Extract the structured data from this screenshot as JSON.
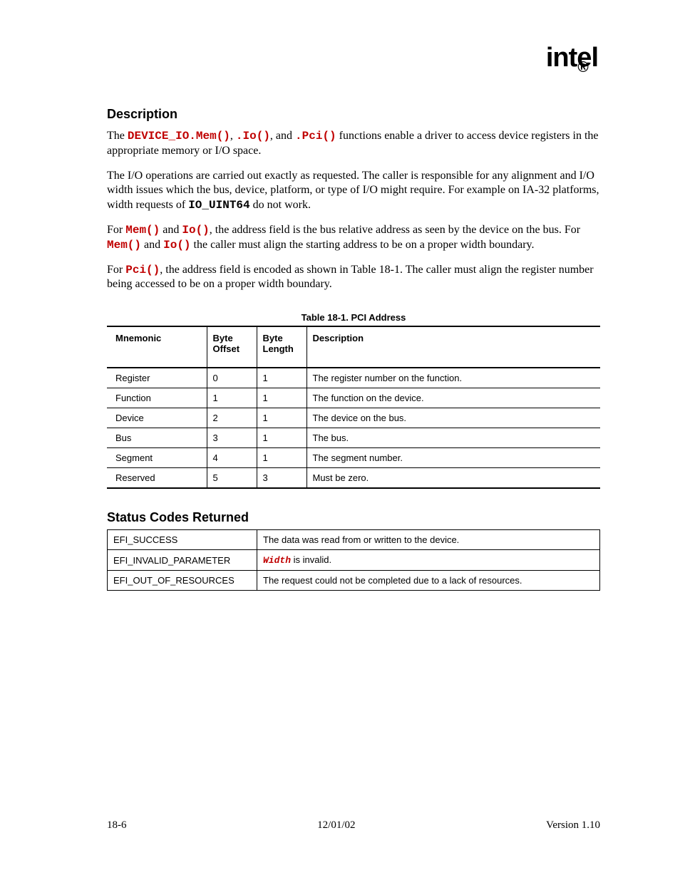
{
  "logo": "intel",
  "sections": {
    "desc_heading": "Description",
    "para1_pre": "The ",
    "para1_code1": "DEVICE_IO.Mem()",
    "para1_sep1": ", ",
    "para1_code2": ".Io()",
    "para1_sep2": ", and ",
    "para1_code3": ".Pci()",
    "para1_post": " functions enable a driver to access device registers in the appropriate memory or I/O space.",
    "para2_pre": "The I/O operations are carried out exactly as requested.  The caller is responsible for any alignment and I/O width issues which the bus, device, platform, or type of I/O might require.  For example on IA-32 platforms, width requests of ",
    "para2_code": "IO_UINT64",
    "para2_post": " do not work.",
    "para3_pre": "For ",
    "para3_code1": "Mem()",
    "para3_mid1": " and ",
    "para3_code2": "Io()",
    "para3_post1": ", the address field is the bus relative address as seen by the device on the bus. For ",
    "para3_code3": "Mem()",
    "para3_mid2": " and ",
    "para3_code4": "Io()",
    "para3_post2": " the caller must align the starting address to be on a proper width boundary.",
    "para4_pre": "For ",
    "para4_code": "Pci()",
    "para4_post": ", the address field is encoded as shown in Table 18-1.  The caller must align the register number being accessed to be on a proper width boundary."
  },
  "table1": {
    "caption": "Table 18-1. PCI Address",
    "headers": {
      "h1": "Mnemonic",
      "h2": "Byte Offset",
      "h3": "Byte Length",
      "h4": "Description"
    },
    "rows": [
      {
        "c1": "Register",
        "c2": "0",
        "c3": "1",
        "c4": "The register number on the function."
      },
      {
        "c1": "Function",
        "c2": "1",
        "c3": "1",
        "c4": "The function on the device."
      },
      {
        "c1": "Device",
        "c2": "2",
        "c3": "1",
        "c4": "The device on the bus."
      },
      {
        "c1": "Bus",
        "c2": "3",
        "c3": "1",
        "c4": "The bus."
      },
      {
        "c1": "Segment",
        "c2": "4",
        "c3": "1",
        "c4": "The segment number."
      },
      {
        "c1": "Reserved",
        "c2": "5",
        "c3": "3",
        "c4": "Must be zero."
      }
    ]
  },
  "status_heading": "Status Codes Returned",
  "table2": {
    "rows": [
      {
        "s1": "EFI_SUCCESS",
        "s2": "The data was read from or written to the device."
      },
      {
        "s1": "EFI_INVALID_PARAMETER",
        "s2_code": "Width",
        "s2_post": " is invalid."
      },
      {
        "s1": "EFI_OUT_OF_RESOURCES",
        "s2": "The request could not be completed due to a lack of resources."
      }
    ]
  },
  "footer": {
    "left": "18-6",
    "center": "12/01/02",
    "right": "Version 1.10"
  }
}
